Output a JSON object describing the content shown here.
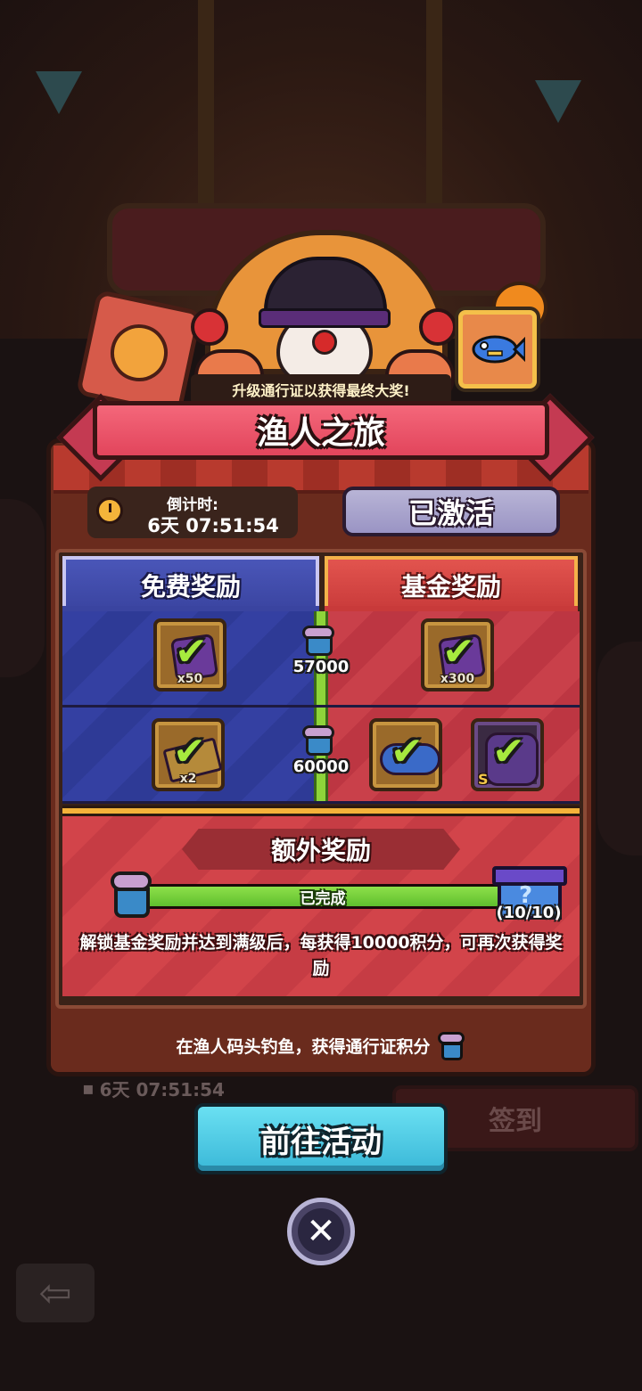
{
  "background": {
    "bottom_timer": "6天 07:51:54",
    "signin_label": "签到"
  },
  "popup": {
    "subtitle": "升级通行证以获得最终大奖!",
    "title": "渔人之旅",
    "countdown": {
      "label": "倒计时:",
      "value": "6天 07:51:54"
    },
    "status_button": "已激活",
    "columns": {
      "free": "免费奖励",
      "fund": "基金奖励"
    },
    "tiers": [
      {
        "points": "57000",
        "free_rewards": [
          {
            "icon": "purple-gem-icon",
            "qty": "x50",
            "claimed": true
          }
        ],
        "fund_rewards": [
          {
            "icon": "purple-gem-icon",
            "qty": "x300",
            "claimed": true
          }
        ]
      },
      {
        "points": "60000",
        "free_rewards": [
          {
            "icon": "ticket-icon",
            "qty": "x2",
            "claimed": true
          }
        ],
        "fund_rewards": [
          {
            "icon": "fish-icon",
            "qty": "",
            "claimed": true
          },
          {
            "icon": "monster-card-icon",
            "grade": "S",
            "claimed": true
          }
        ]
      }
    ],
    "extra": {
      "title": "额外奖励",
      "progress_label": "已完成",
      "progress": 1.0,
      "count": "(10/10)",
      "description": "解锁基金奖励并达到满级后，每获得10000积分，可再次获得奖励"
    },
    "hint": "在渔人码头钓鱼，获得通行证积分",
    "goto_button": "前往活动",
    "close_icon": "close-icon"
  },
  "colors": {
    "free_blue": "#3a44a0",
    "fund_red": "#c83a3a",
    "progress_green": "#8ee04a",
    "goto_cyan": "#4ac8e4"
  }
}
